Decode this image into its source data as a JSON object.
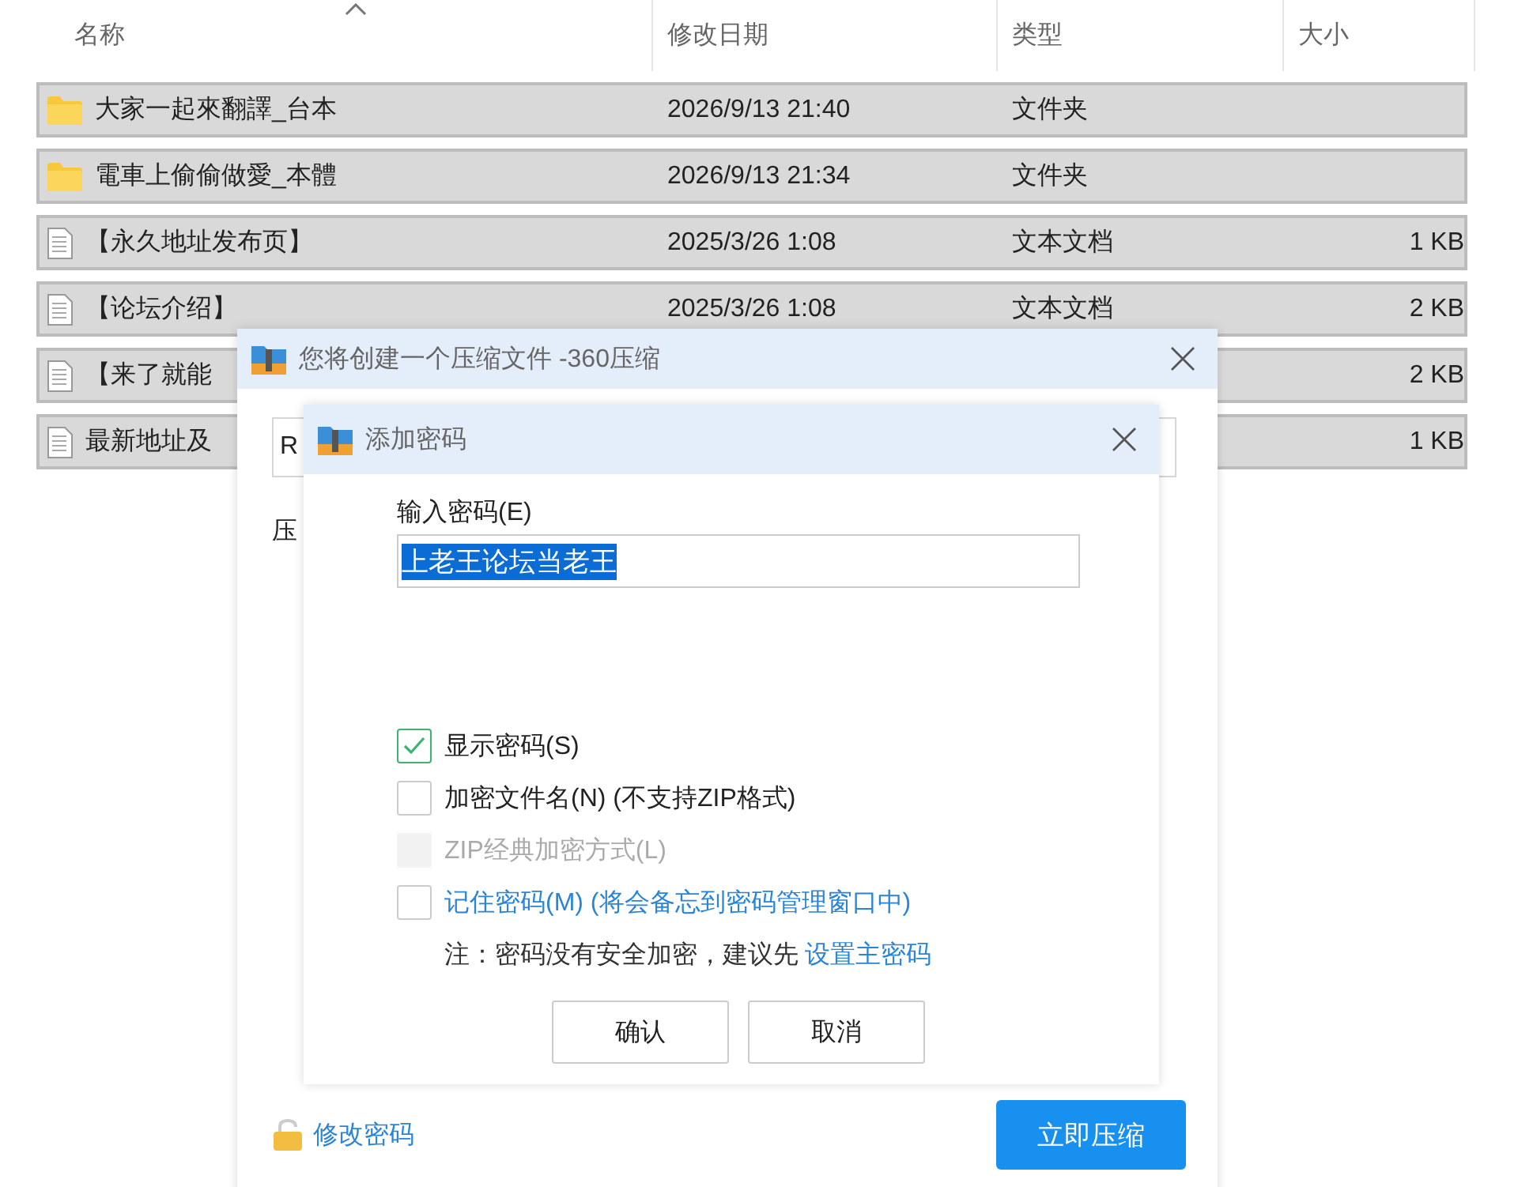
{
  "columns": [
    {
      "label": "名称",
      "sorted": true
    },
    {
      "label": "修改日期",
      "sorted": false
    },
    {
      "label": "类型",
      "sorted": false
    },
    {
      "label": "大小",
      "sorted": false
    }
  ],
  "files": [
    {
      "kind": "folder",
      "name": "大家一起來翻譯_台本",
      "date": "2026/9/13 21:40",
      "type": "文件夹",
      "selected": true
    },
    {
      "kind": "folder",
      "name": "電車上偷偷做愛_本體",
      "date": "2026/9/13 21:34",
      "type": "文件夹",
      "selected": true
    },
    {
      "kind": "text",
      "name": "【永久地址发布页】",
      "date": "2025/3/26 1:08",
      "type": "文本文档",
      "size": "1 KB",
      "selected": true
    },
    {
      "kind": "text",
      "name": "【论坛介绍】",
      "date": "2025/3/26 1:08",
      "type": "文本文档",
      "size": "2 KB",
      "selected": true
    },
    {
      "kind": "text",
      "name": "【来了就能",
      "size": "2 KB",
      "selected": true
    },
    {
      "kind": "text",
      "name": "最新地址及",
      "size": "1 KB",
      "selected": true
    }
  ],
  "compress_dialog": {
    "title": "您将创建一个压缩文件 -360压缩",
    "path_value": "R",
    "label": "压",
    "change_password_link": "修改密码",
    "compress_button": "立即压缩"
  },
  "password_dialog": {
    "title": "添加密码",
    "input_label": "输入密码(E)",
    "password_value": "上老王论坛当老王",
    "value_selected": true,
    "options": [
      {
        "kind": "plain",
        "label": "显示密码(S)",
        "checked": true,
        "disabled": false
      },
      {
        "kind": "plain",
        "label": "加密文件名(N) (不支持ZIP格式)",
        "checked": false,
        "disabled": false
      },
      {
        "kind": "plain",
        "label": "ZIP经典加密方式(L)",
        "checked": false,
        "disabled": true
      },
      {
        "kind": "link",
        "label": "记住密码(M) (将会备忘到密码管理窗口中)",
        "checked": false,
        "disabled": false
      }
    ],
    "note": "注：密码没有安全加密，建议先",
    "note_link": "设置主密码",
    "buttons": [
      "确认",
      "取消"
    ]
  }
}
